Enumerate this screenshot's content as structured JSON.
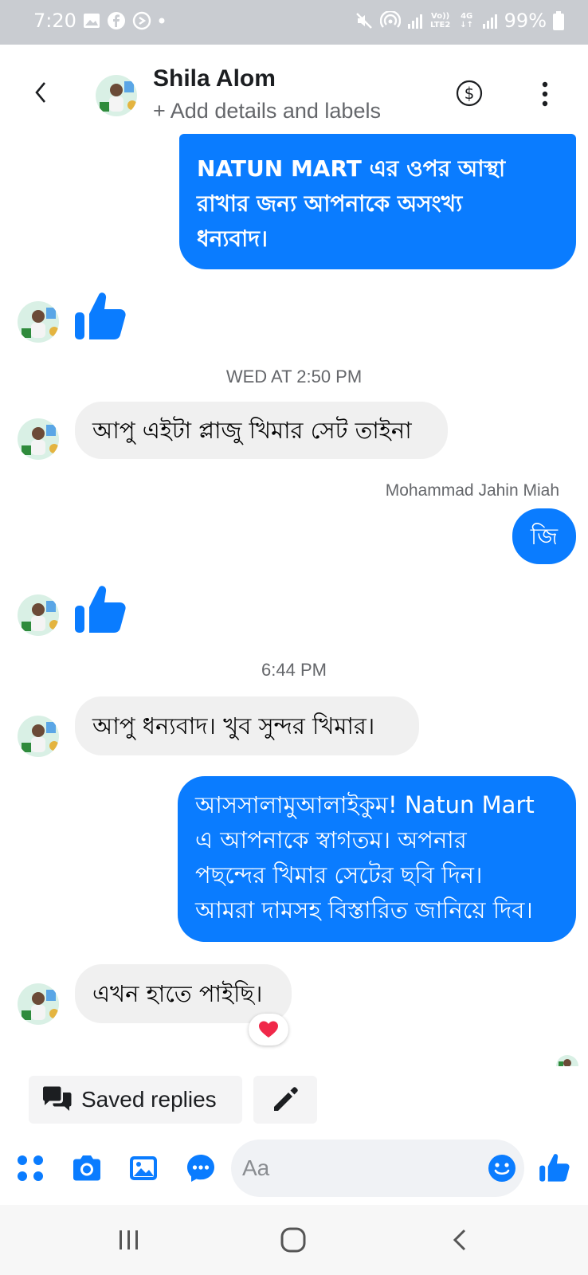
{
  "status_bar": {
    "time": "7:20",
    "battery": "99%",
    "network": [
      "Vo)) LTE2",
      "4G ↓↑"
    ]
  },
  "header": {
    "contact_name": "Shila Alom",
    "subtitle": "+ Add details and labels"
  },
  "messages": {
    "m1": [
      "NATUN MART এর ওপর আস্থা",
      "রাখার জন্য আপনাকে অসংখ্য",
      "ধন্যবাদ।"
    ],
    "ts1": "WED AT 2:50 PM",
    "m2": "আপু এইটা প্লাজু খিমার সেট তাইনা",
    "sender1": "Mohammad Jahin Miah",
    "m3": "জি",
    "ts2": "6:44 PM",
    "m4": "আপু ধন্যবাদ। খুব সুন্দর খিমার।",
    "m5": [
      "আসসালামুআলাইকুম! Natun Mart",
      "এ আপনাকে স্বাগতম। অপনার",
      "পছন্দের খিমার সেটের ছবি দিন।",
      "আমরা দামসহ বিস্তারিত জানিয়ে দিব।"
    ],
    "m6": "এখন হাতে পাইছি।"
  },
  "quick_actions": {
    "saved_replies_label": "Saved replies"
  },
  "composer": {
    "placeholder": "Aa"
  },
  "colors": {
    "accent": "#0a7cff",
    "incoming_bubble": "#f0f0f0",
    "reaction_heart": "#f02849"
  }
}
